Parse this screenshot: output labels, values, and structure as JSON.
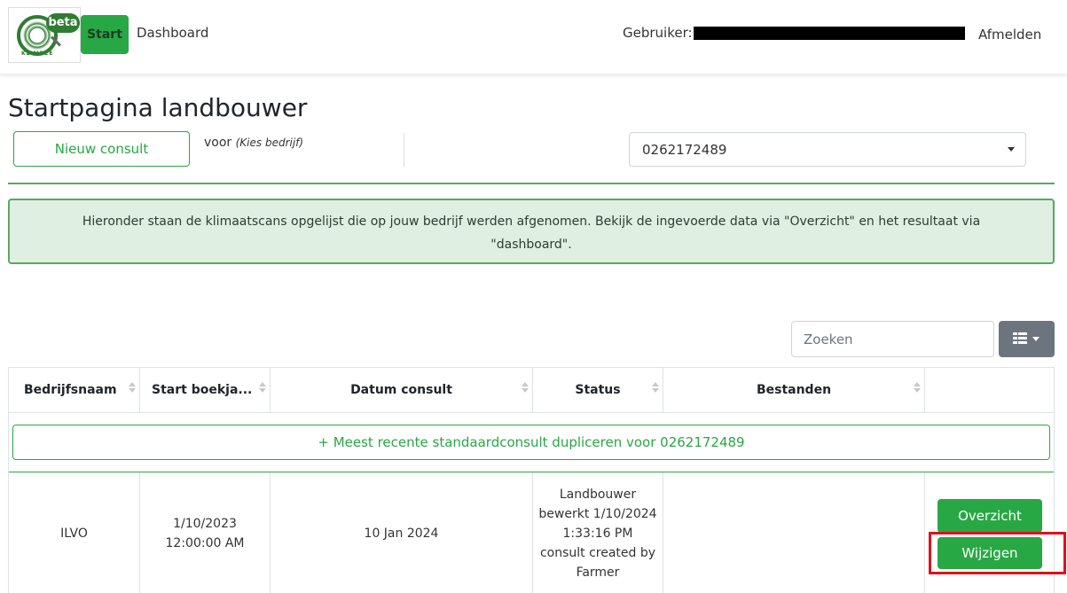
{
  "header": {
    "logo_badge": "beta",
    "logo_text": "KLIMBEE",
    "nav_start": "Start",
    "nav_dashboard": "Dashboard",
    "user_label": "Gebruiker:",
    "logout": "Afmelden"
  },
  "page": {
    "title": "Startpagina landbouwer",
    "new_consult_button": "Nieuw consult",
    "voor_label": "voor",
    "voor_hint": "(Kies bedrijf)",
    "company_select_value": "0262172489",
    "info_text": "Hieronder staan de klimaatscans opgelijst die op jouw bedrijf werden afgenomen. Bekijk de ingevoerde data via \"Overzicht\" en het resultaat via \"dashboard\"."
  },
  "toolbar": {
    "search_placeholder": "Zoeken"
  },
  "table": {
    "headers": {
      "bedrijfsnaam": "Bedrijfsnaam",
      "start": "Start boekja...",
      "datum": "Datum consult",
      "status": "Status",
      "bestanden": "Bestanden",
      "actions": ""
    },
    "duplicate_button": "+ Meest recente standaardconsult dupliceren voor 0262172489",
    "rows": [
      {
        "bedrijfsnaam": "ILVO",
        "start": "1/10/2023 12:00:00 AM",
        "datum": "10 Jan 2024",
        "status": "Landbouwer bewerkt 1/10/2024 1:33:16 PM consult created by Farmer",
        "bestanden": "",
        "overzicht": "Overzicht",
        "wijzigen": "Wijzigen"
      }
    ]
  },
  "colors": {
    "accent": "#28a745",
    "highlight": "#e0101a"
  }
}
